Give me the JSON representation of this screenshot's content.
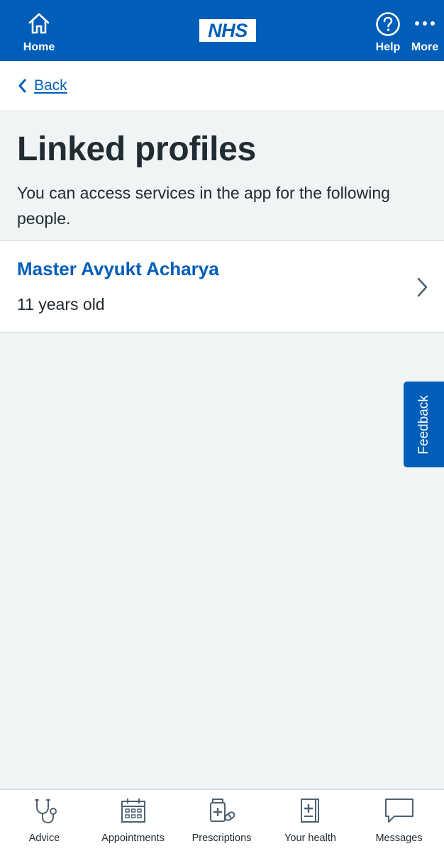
{
  "header": {
    "home_label": "Home",
    "logo_text": "NHS",
    "help_label": "Help",
    "more_label": "More"
  },
  "back": {
    "label": "Back"
  },
  "page": {
    "title": "Linked profiles",
    "intro": "You can access services in the app for the following people."
  },
  "profiles": [
    {
      "name": "Master Avyukt Acharya",
      "age": "11 years old"
    }
  ],
  "feedback": {
    "label": "Feedback"
  },
  "tabs": [
    {
      "label": "Advice",
      "icon": "stethoscope-icon"
    },
    {
      "label": "Appointments",
      "icon": "calendar-icon"
    },
    {
      "label": "Prescriptions",
      "icon": "medicine-icon"
    },
    {
      "label": "Your health",
      "icon": "health-record-icon"
    },
    {
      "label": "Messages",
      "icon": "message-icon"
    }
  ],
  "colors": {
    "nhs_blue": "#005eb8",
    "text": "#212b32",
    "background": "#f0f4f5"
  }
}
